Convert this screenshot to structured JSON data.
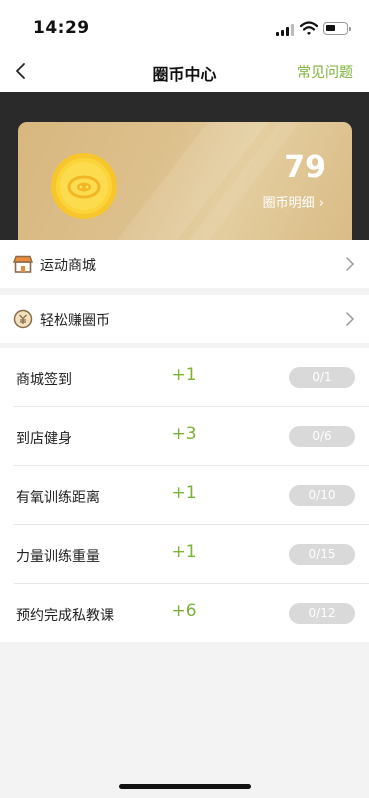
{
  "status_bar": {
    "time": "14:29",
    "battery_level": 0.35
  },
  "nav": {
    "title": "圈币中心",
    "faq_label": "常见问题",
    "back_icon": "chevron-left-icon"
  },
  "coin_card": {
    "balance": "79",
    "detail_label": "圈币明细 ›",
    "coin_icon": "pig-coin-icon",
    "colors": {
      "card": "#dcc08c",
      "coin": "#fbd43a",
      "hero_background": "#2a2a2a"
    }
  },
  "menu": {
    "items": [
      {
        "label": "运动商城",
        "icon": "store-icon"
      },
      {
        "label": "轻松赚圈币",
        "icon": "coin-icon"
      }
    ]
  },
  "tasks": [
    {
      "name": "商城签到",
      "points": "+1",
      "progress": "0/1"
    },
    {
      "name": "到店健身",
      "points": "+3",
      "progress": "0/6"
    },
    {
      "name": "有氧训练距离",
      "points": "+1",
      "progress": "0/10"
    },
    {
      "name": "力量训练重量",
      "points": "+1",
      "progress": "0/15"
    },
    {
      "name": "预约完成私教课",
      "points": "+6",
      "progress": "0/12"
    }
  ],
  "colors": {
    "accent_green": "#7ab335",
    "progress_pill": "#d9d9d9"
  }
}
